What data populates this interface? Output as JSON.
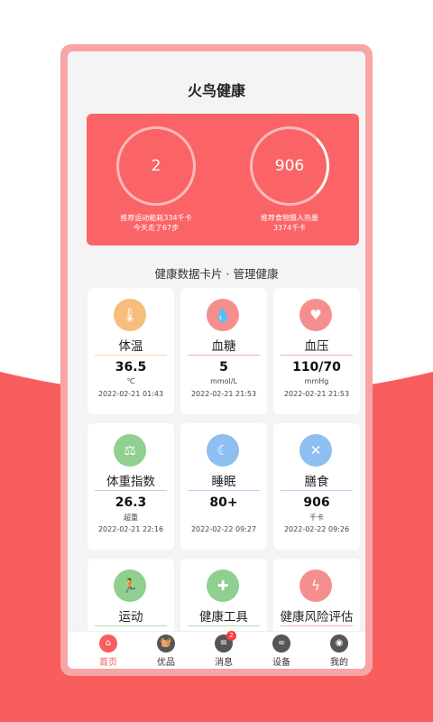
{
  "app": {
    "title": "火鸟健康"
  },
  "hero": {
    "left": {
      "value": "2",
      "caption1": "推荐运动能耗334千卡",
      "caption2": "今天走了67步"
    },
    "right": {
      "value": "906",
      "caption1": "推荐食物摄入热量",
      "caption2": "3374千卡"
    }
  },
  "subhead": "健康数据卡片 · 管理健康",
  "cards": [
    {
      "name": "体温",
      "value": "36.5",
      "unit": "℃",
      "time": "2022-02-21 01:43",
      "icon": "thermometer-icon",
      "color": "#f7bd7b",
      "line": "#f5d6a8"
    },
    {
      "name": "血糖",
      "value": "5",
      "unit": "mmol/L",
      "time": "2022-02-21 21:53",
      "icon": "blood-drop-icon",
      "color": "#f58f8f",
      "line": "#f5b1b1"
    },
    {
      "name": "血压",
      "value": "110/70",
      "unit": "mmHg",
      "time": "2022-02-21 21:53",
      "icon": "heart-pulse-icon",
      "color": "#f58f8f",
      "line": "#f5b1b1"
    },
    {
      "name": "体重指数",
      "value": "26.3",
      "unit": "超重",
      "time": "2022-02-21 22:16",
      "icon": "scale-icon",
      "color": "#8fcf8f",
      "line": "#b6deb6"
    },
    {
      "name": "睡眠",
      "value": "80+",
      "unit": "",
      "time": "2022-02-22 09:27",
      "icon": "moon-icon",
      "color": "#8dbff0",
      "line": "#b4d4f2"
    },
    {
      "name": "膳食",
      "value": "906",
      "unit": "千卡",
      "time": "2022-02-22 09:26",
      "icon": "cutlery-icon",
      "color": "#8dbff0",
      "line": "#b4d4f2"
    },
    {
      "name": "运动",
      "value": "",
      "unit": "",
      "time": "",
      "icon": "runner-icon",
      "color": "#8fcf8f",
      "line": "#b6deb6"
    },
    {
      "name": "健康工具",
      "value": "",
      "unit": "",
      "time": "",
      "icon": "medkit-icon",
      "color": "#8fcf8f",
      "line": "#b6deb6"
    },
    {
      "name": "健康风险评估",
      "value": "",
      "unit": "",
      "time": "",
      "icon": "lightning-icon",
      "color": "#f58f8f",
      "line": "#f5b1b1"
    }
  ],
  "tabs": [
    {
      "label": "首页",
      "icon": "home-icon",
      "active": true
    },
    {
      "label": "优品",
      "icon": "basket-icon"
    },
    {
      "label": "消息",
      "icon": "message-icon",
      "badge": "2"
    },
    {
      "label": "设备",
      "icon": "device-icon"
    },
    {
      "label": "我的",
      "icon": "user-icon"
    }
  ],
  "colors": {
    "accent": "#fa5d5e",
    "hero_bg": "#fa6466",
    "phone_frame": "#f7a5a5"
  }
}
